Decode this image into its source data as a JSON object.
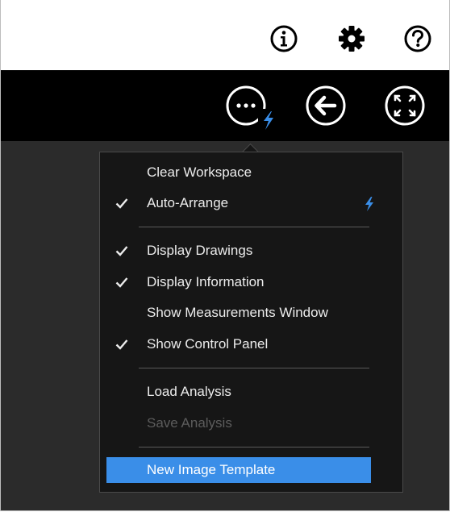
{
  "top_bar": {
    "icons": [
      "info-icon",
      "gear-icon",
      "help-icon"
    ]
  },
  "toolbar": {
    "buttons": [
      "more-options-icon",
      "back-arrow-icon",
      "fullscreen-icon"
    ],
    "more_badge_icon": "lightning-bolt-icon"
  },
  "menu": {
    "items": [
      {
        "label": "Clear Workspace",
        "checked": false,
        "enabled": true
      },
      {
        "label": "Auto-Arrange",
        "checked": true,
        "enabled": true,
        "badge_icon": "lightning-bolt-icon"
      },
      {
        "label": "Display Drawings",
        "checked": true,
        "enabled": true
      },
      {
        "label": "Display Information",
        "checked": true,
        "enabled": true
      },
      {
        "label": "Show Measurements Window",
        "checked": false,
        "enabled": true
      },
      {
        "label": "Show Control Panel",
        "checked": true,
        "enabled": true
      },
      {
        "label": "Load Analysis",
        "checked": false,
        "enabled": true
      },
      {
        "label": "Save Analysis",
        "checked": false,
        "enabled": false
      },
      {
        "label": "New Image Template",
        "checked": false,
        "enabled": true,
        "highlighted": true
      }
    ]
  },
  "colors": {
    "toolbar_bg": "#000000",
    "workspace_bg": "#2b2b2b",
    "menu_bg": "#161616",
    "highlight": "#3a8ee8",
    "bolt": "#3a8ee8",
    "disabled_text": "#5c5c5c"
  }
}
